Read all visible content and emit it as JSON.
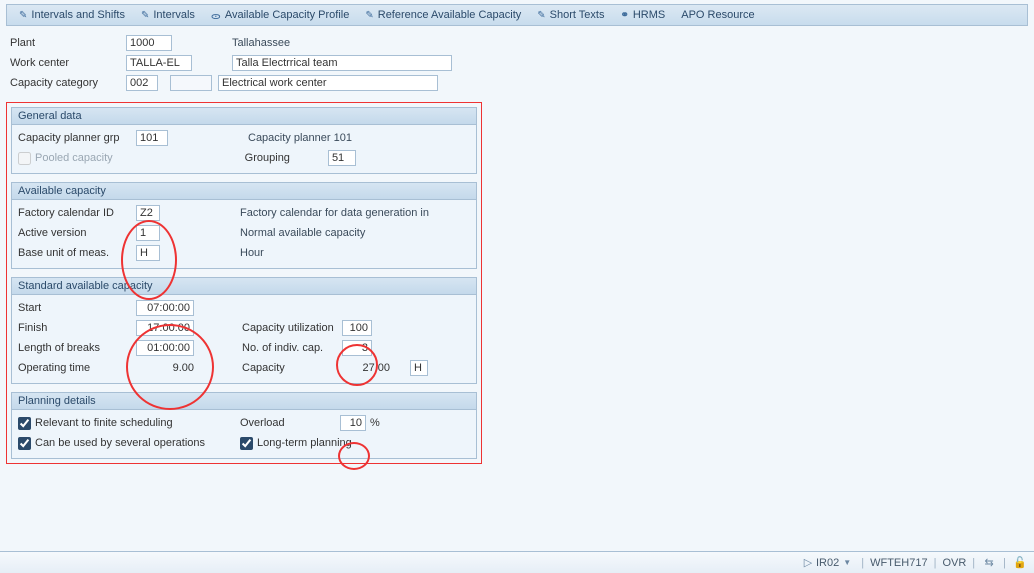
{
  "toolbar": {
    "intervals_shifts": "Intervals and Shifts",
    "intervals": "Intervals",
    "avail_profile": "Available Capacity Profile",
    "ref_avail": "Reference Available Capacity",
    "short_texts": "Short Texts",
    "hrms": "HRMS",
    "apo": "APO Resource"
  },
  "header": {
    "plant_lbl": "Plant",
    "plant_val": "1000",
    "plant_desc": "Tallahassee",
    "wc_lbl": "Work center",
    "wc_val": "TALLA-EL",
    "wc_desc": "Talla Electrrical team",
    "cap_lbl": "Capacity category",
    "cap_val": "002",
    "cap_desc": "Electrical work center"
  },
  "general": {
    "title": "General data",
    "planner_lbl": "Capacity planner grp",
    "planner_val": "101",
    "planner_desc": "Capacity planner 101",
    "pooled_lbl": "Pooled capacity",
    "grouping_lbl": "Grouping",
    "grouping_val": "51"
  },
  "available": {
    "title": "Available capacity",
    "cal_lbl": "Factory calendar ID",
    "cal_val": "Z2",
    "cal_desc": "Factory calendar for data generation in",
    "ver_lbl": "Active version",
    "ver_val": "1",
    "ver_desc": "Normal available capacity",
    "uom_lbl": "Base unit of meas.",
    "uom_val": "H",
    "uom_desc": "Hour"
  },
  "standard": {
    "title": "Standard available capacity",
    "start_lbl": "Start",
    "start_val": "07:00:00",
    "finish_lbl": "Finish",
    "finish_val": "17:00:00",
    "cutil_lbl": "Capacity utilization",
    "cutil_val": "100",
    "breaks_lbl": "Length of breaks",
    "breaks_val": "01:00:00",
    "indiv_lbl": "No. of indiv. cap.",
    "indiv_val": "3",
    "optime_lbl": "Operating time",
    "optime_val": "9.00",
    "capacity_lbl": "Capacity",
    "capacity_val": "27.00",
    "capacity_unit": "H"
  },
  "planning": {
    "title": "Planning details",
    "finite_lbl": "Relevant to finite scheduling",
    "overload_lbl": "Overload",
    "overload_val": "10",
    "overload_unit": "%",
    "several_lbl": "Can be used by several operations",
    "longterm_lbl": "Long-term planning"
  },
  "status": {
    "tcode": "IR02",
    "system": "WFTEH717",
    "mode": "OVR"
  }
}
